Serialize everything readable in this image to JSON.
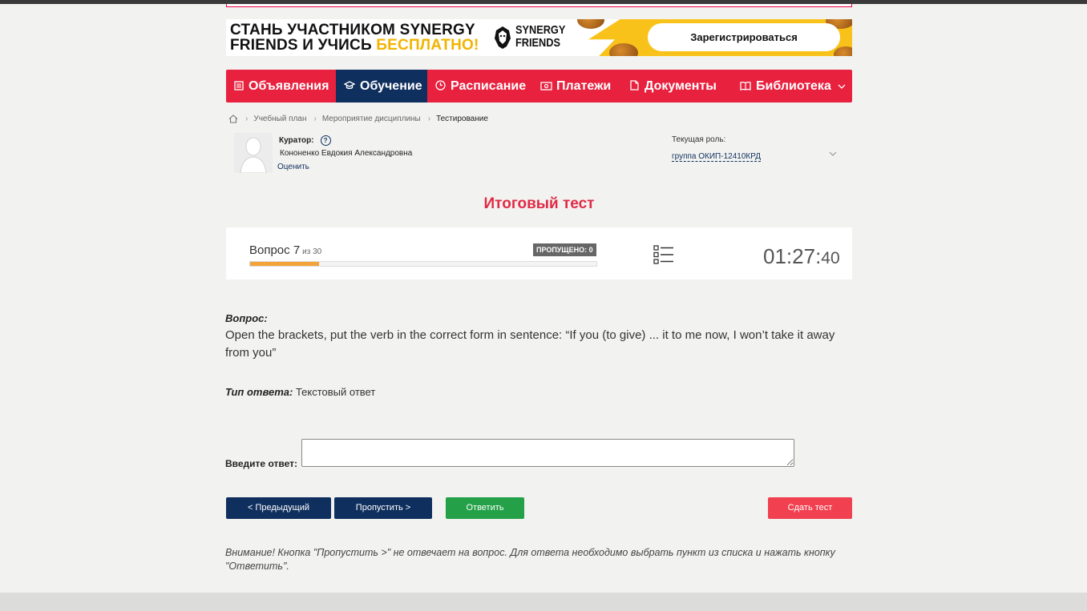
{
  "banner": {
    "line1": "СТАНЬ УЧАСТНИКОМ SYNERGY",
    "line2_prefix": "FRIENDS И УЧИСЬ ",
    "line2_highlight": "БЕСПЛАТНО!",
    "logo_line1": "SYNERGY",
    "logo_line2": "FRIENDS",
    "register_button": "Зарегистрироваться"
  },
  "nav": {
    "items": [
      {
        "label": "Объявления",
        "icon": "list-icon"
      },
      {
        "label": "Обучение",
        "icon": "graduation-cap-icon",
        "active": true
      },
      {
        "label": "Расписание",
        "icon": "clock-icon"
      },
      {
        "label": "Платежи",
        "icon": "money-icon"
      },
      {
        "label": "Документы",
        "icon": "document-icon"
      },
      {
        "label": "Библиотека",
        "icon": "book-icon",
        "has_dropdown": true
      }
    ]
  },
  "breadcrumb": {
    "items": [
      "Учебный план",
      "Мероприятие дисциплины",
      "Тестирование"
    ]
  },
  "curator": {
    "label": "Куратор:",
    "name": "Кононенко Евдокия Александровна",
    "rate_link": "Оценить"
  },
  "role": {
    "label": "Текущая роль:",
    "value": "группа ОКИП-12410КРД"
  },
  "test": {
    "title": "Итоговый тест",
    "question_prefix": "Вопрос 7",
    "question_of": "из 30",
    "skipped_badge": "ПРОПУЩЕНО: 0",
    "progress_fraction": 0.2,
    "timer_main": "01:27:",
    "timer_seconds": "40"
  },
  "question": {
    "label": "Вопрос:",
    "text": "Open the brackets, put the verb in the correct form in sentence: “If you (to give) ... it to me now, I won’t take it away from you”",
    "type_label": "Тип ответа:",
    "type_value": " Текстовый ответ",
    "answer_label": "Введите ответ:",
    "answer_value": ""
  },
  "buttons": {
    "prev": "< Предыдущий",
    "skip": "Пропустить >",
    "answer": "Ответить",
    "submit": "Сдать тест"
  },
  "note": "Внимание! Кнопка \"Пропустить >\" не отвечает на вопрос. Для ответа необходимо выбрать пункт из списка и нажать кнопку \"Ответить\".",
  "colors": {
    "nav_red": "#e8213e",
    "nav_active": "#0f2f5e",
    "title_red": "#e02a45",
    "progress_orange": "#f2a33a",
    "answer_green": "#24a148",
    "submit_red": "#f1404f"
  }
}
